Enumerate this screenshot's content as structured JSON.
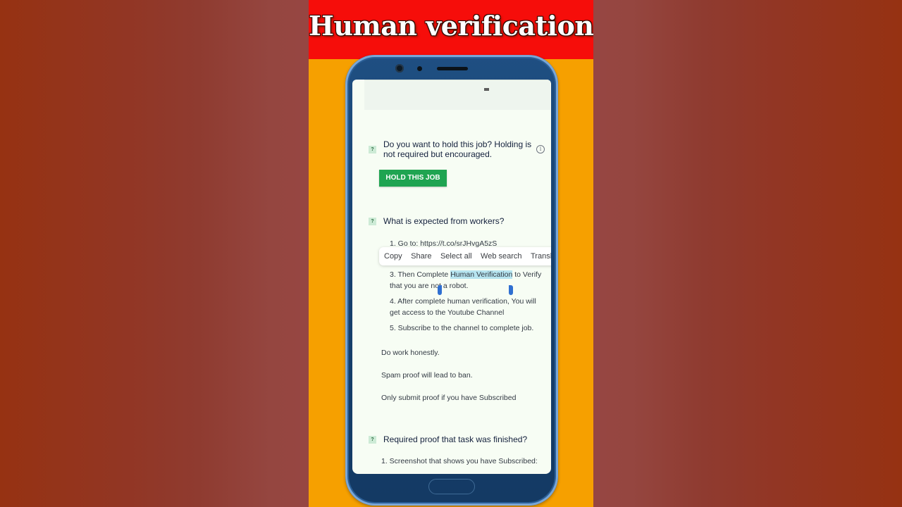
{
  "banner": {
    "title": "Human verification"
  },
  "colors": {
    "banner_red": "#f60d0a",
    "stage_orange": "#f6a000",
    "phone_blue": "#1f4f82",
    "hold_button_green": "#1fa451",
    "selection_highlight": "#b6e4ef",
    "selection_handle_blue": "#2f6fd1"
  },
  "job": {
    "hold_question": {
      "badge": "?",
      "line1": "Do you want to hold this job? Holding is",
      "line2": "not required but encouraged.",
      "info_icon": "i",
      "button_label": "HOLD THIS JOB"
    },
    "expected": {
      "badge": "?",
      "title": "What is expected from workers?",
      "step1": "1. Go to: https://t.co/srJHvgA5zS",
      "step3_before": "3. Then Complete ",
      "step3_selected": "Human Verification",
      "step3_after": " to Verify",
      "step3_line2": "that you are not a robot.",
      "step4_line1": "4. After complete human verification, You will",
      "step4_line2": "get access to the Youtube Channel",
      "step5": "5. Subscribe to the channel to complete job.",
      "note1": "Do work honestly.",
      "note2": "Spam proof will lead to ban.",
      "note3": "Only submit proof if you have Subscribed"
    },
    "proof": {
      "badge": "?",
      "title": "Required proof that task was finished?",
      "item1": "1. Screenshot that shows you have Subscribed:"
    }
  },
  "context_menu": {
    "items": [
      "Copy",
      "Share",
      "Select all",
      "Web search",
      "Translate"
    ]
  }
}
